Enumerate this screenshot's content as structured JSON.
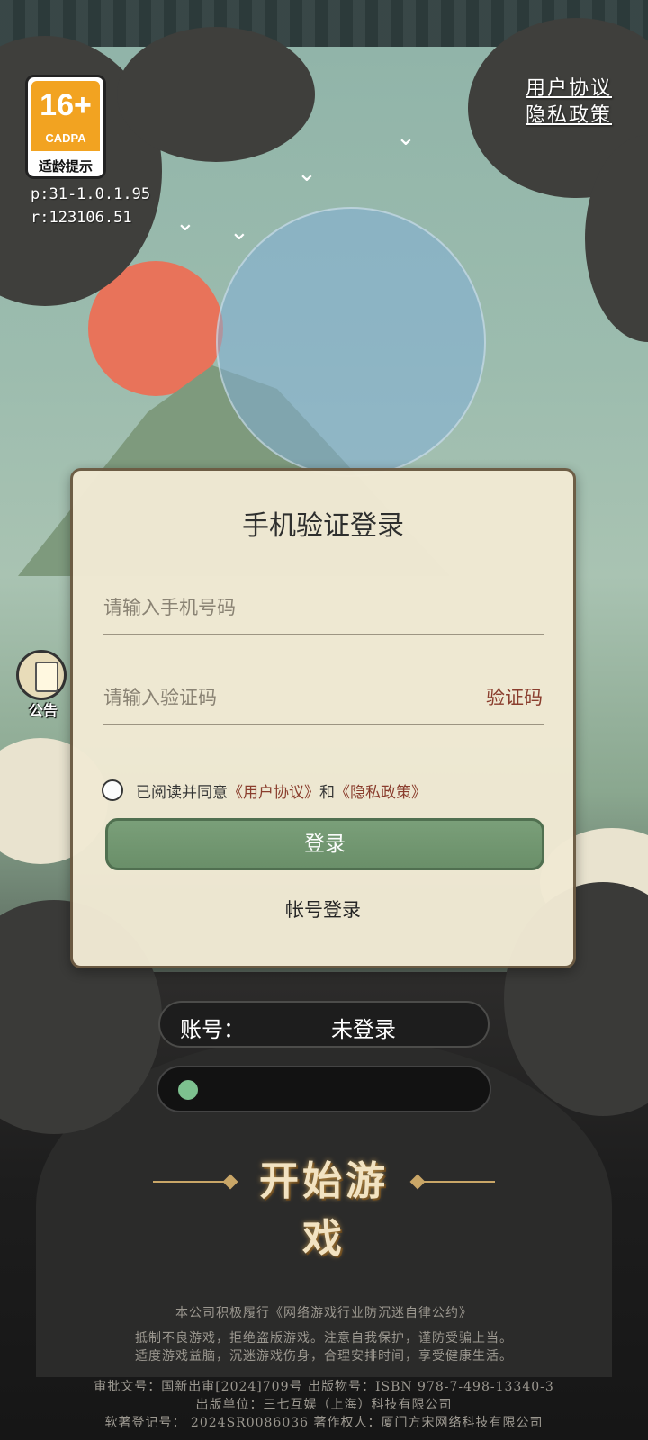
{
  "age_rating": {
    "number": "16+",
    "org": "CADPA",
    "hint": "适龄提示"
  },
  "version": {
    "p": "p:31-1.0.1.95",
    "r": "r:123106.51"
  },
  "top_links": {
    "user_agreement": "用户协议",
    "privacy_policy": "隐私政策"
  },
  "notice": {
    "label": "公告",
    "icon": "scroll-icon"
  },
  "login_dialog": {
    "title": "手机验证登录",
    "phone_placeholder": "请输入手机号码",
    "code_placeholder": "请输入验证码",
    "code_button": "验证码",
    "agree_prefix": "已阅读并同意",
    "agree_link_user": "《用户协议》",
    "agree_and": "和",
    "agree_link_privacy": "《隐私政策》",
    "login_button": "登录",
    "account_login": "帐号登录"
  },
  "account": {
    "label": "账号：",
    "value": "未登录"
  },
  "start_game": "开始游戏",
  "footer": {
    "line1": "本公司积极履行《网络游戏行业防沉迷自律公约》",
    "line2": "抵制不良游戏，拒绝盗版游戏。注意自我保护，谨防受骗上当。",
    "line3": "适度游戏益脑，沉迷游戏伤身，合理安排时间，享受健康生活。",
    "line4": "审批文号：国新出审[2024]709号 出版物号：ISBN 978-7-498-13340-3",
    "line5": "出版单位：三七互娱（上海）科技有限公司",
    "line6": "软著登记号： 2024SR0086036 著作权人：厦门方宋网络科技有限公司"
  },
  "colors": {
    "dialog_bg": "#f1ead4",
    "login_button": "#6a9069",
    "link_red": "#8a3a2a",
    "age_orange": "#f2a321"
  }
}
